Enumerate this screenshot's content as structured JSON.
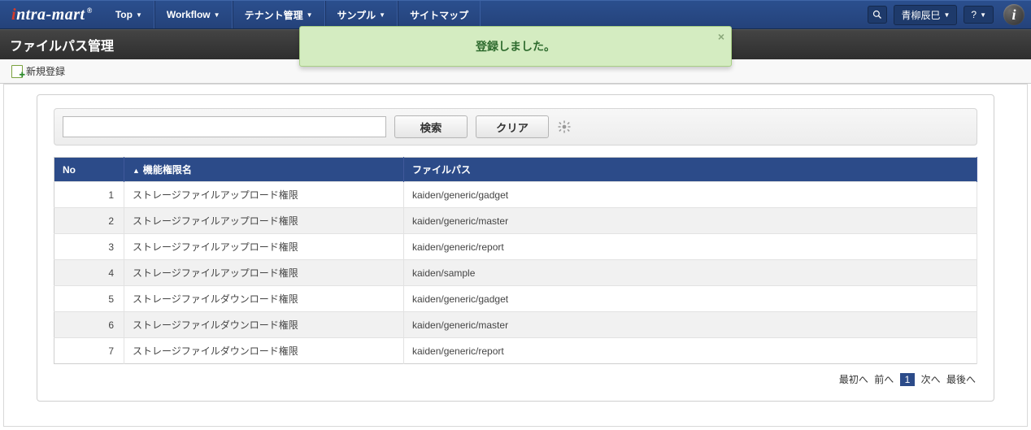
{
  "nav": {
    "logo_prefix": "ntra-mart",
    "items": [
      "Top",
      "Workflow",
      "テナント管理",
      "サンプル",
      "サイトマップ"
    ],
    "user": "青柳辰巳",
    "help": "?"
  },
  "page": {
    "title": "ファイルパス管理"
  },
  "toolbar": {
    "new_label": "新規登録"
  },
  "toast": {
    "message": "登録しました。"
  },
  "search": {
    "search_label": "検索",
    "clear_label": "クリア",
    "value": ""
  },
  "grid": {
    "headers": {
      "no": "No",
      "name": "機能権限名",
      "path": "ファイルパス"
    },
    "rows": [
      {
        "no": "1",
        "name": "ストレージファイルアップロード権限",
        "path": "kaiden/generic/gadget"
      },
      {
        "no": "2",
        "name": "ストレージファイルアップロード権限",
        "path": "kaiden/generic/master"
      },
      {
        "no": "3",
        "name": "ストレージファイルアップロード権限",
        "path": "kaiden/generic/report"
      },
      {
        "no": "4",
        "name": "ストレージファイルアップロード権限",
        "path": "kaiden/sample"
      },
      {
        "no": "5",
        "name": "ストレージファイルダウンロード権限",
        "path": "kaiden/generic/gadget"
      },
      {
        "no": "6",
        "name": "ストレージファイルダウンロード権限",
        "path": "kaiden/generic/master"
      },
      {
        "no": "7",
        "name": "ストレージファイルダウンロード権限",
        "path": "kaiden/generic/report"
      }
    ]
  },
  "pager": {
    "first": "最初へ",
    "prev": "前へ",
    "page": "1",
    "next": "次へ",
    "last": "最後へ"
  }
}
